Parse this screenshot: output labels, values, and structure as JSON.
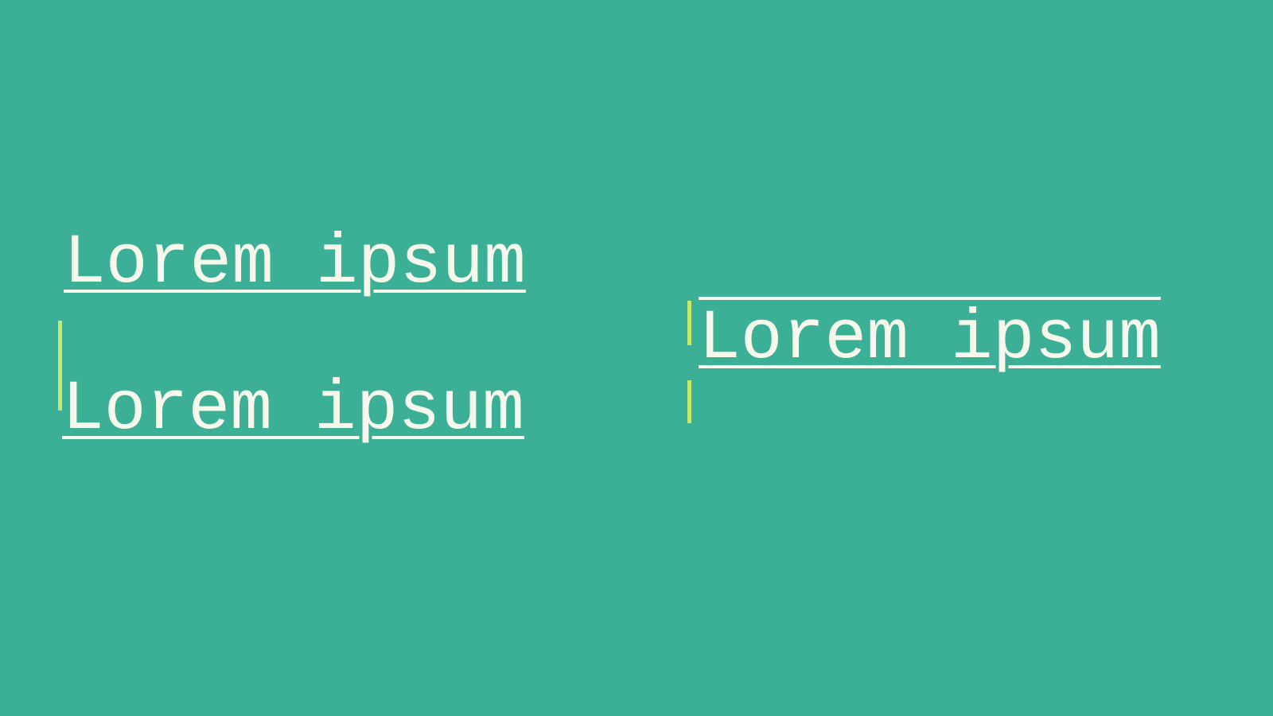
{
  "items": [
    {
      "text": "Lorem ipsum"
    },
    {
      "text": "Lorem ipsum"
    },
    {
      "text": "Lorem ipsum"
    }
  ],
  "colors": {
    "background": "#3bb096",
    "text": "#f5f8ea",
    "caret": "#c8e86e"
  }
}
